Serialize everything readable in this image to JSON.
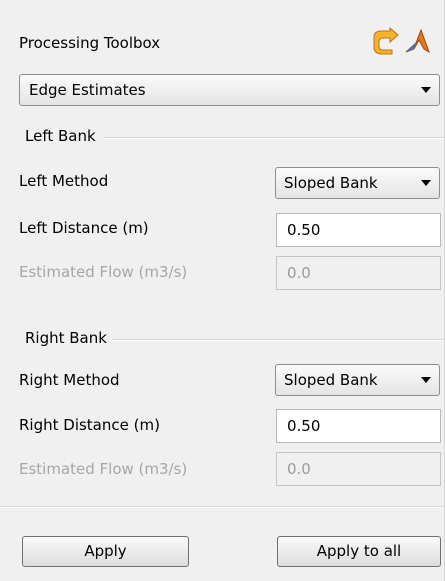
{
  "header": {
    "title": "Processing Toolbox",
    "icons": [
      "refresh-arrow-icon",
      "matlab-icon"
    ]
  },
  "process_select": {
    "value": "Edge Estimates"
  },
  "left_bank": {
    "group_label": "Left Bank",
    "method_label": "Left Method",
    "method_value": "Sloped Bank",
    "distance_label": "Left Distance (m)",
    "distance_value": "0.50",
    "flow_label": "Estimated Flow (m3/s)",
    "flow_value": "0.0"
  },
  "right_bank": {
    "group_label": "Right Bank",
    "method_label": "Right Method",
    "method_value": "Sloped Bank",
    "distance_label": "Right Distance (m)",
    "distance_value": "0.50",
    "flow_label": "Estimated Flow (m3/s)",
    "flow_value": "0.0"
  },
  "buttons": {
    "apply": "Apply",
    "apply_all": "Apply to all"
  },
  "colors": {
    "icon_orange": "#f3a21b",
    "matlab_orange": "#e8771a"
  }
}
